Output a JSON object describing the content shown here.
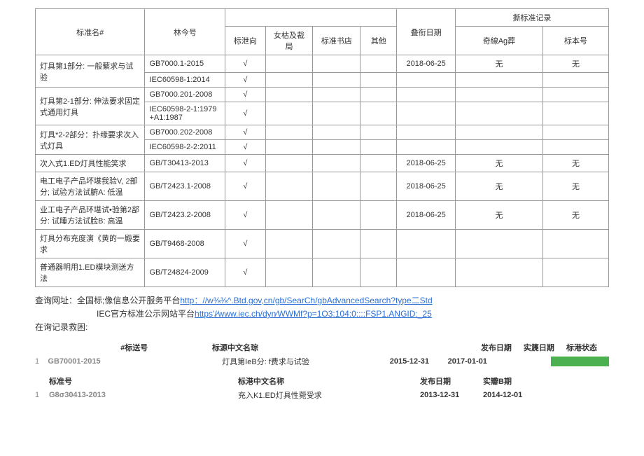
{
  "table": {
    "headers": {
      "name": "标准名#",
      "number": "林今号",
      "group_blank": "",
      "date": "叠衔日期",
      "record_group": "撕标准记录",
      "c1": "标泄向",
      "c2": "女枯及裁局",
      "c3": "标准书店",
      "c4": "其他",
      "r1": "奇線Ag葬",
      "r2": "标本号"
    },
    "rows": [
      {
        "name": "灯具第1部分: 一般蘩求与试验",
        "num": "GB7000.1-2015",
        "c1": "√",
        "c2": "",
        "c3": "",
        "c4": "",
        "date": "2018-06-25",
        "r1": "无",
        "r2": "无",
        "rowspan": 2
      },
      {
        "name": "",
        "num": "IEC60598-1:2014",
        "c1": "√",
        "c2": "",
        "c3": "",
        "c4": "",
        "date": "",
        "r1": "",
        "r2": ""
      },
      {
        "name": "灯具第2-1部分: 伸法要求固定式通用灯具",
        "num": "GB7000.201-2008",
        "c1": "√",
        "c2": "",
        "c3": "",
        "c4": "",
        "date": "",
        "r1": "",
        "r2": "",
        "rowspan": 2
      },
      {
        "name": "",
        "num": "IEC60598-2-1:1979+A1:1987",
        "c1": "√",
        "c2": "",
        "c3": "",
        "c4": "",
        "date": "",
        "r1": "",
        "r2": ""
      },
      {
        "name": "灯具*2-2部分：扑缘要求次入式灯具",
        "num": "GB7000.202-2008",
        "c1": "√",
        "c2": "",
        "c3": "",
        "c4": "",
        "date": "",
        "r1": "",
        "r2": "",
        "rowspan": 2
      },
      {
        "name": "",
        "num": "IEC60598-2-2:2011",
        "c1": "√",
        "c2": "",
        "c3": "",
        "c4": "",
        "date": "",
        "r1": "",
        "r2": ""
      },
      {
        "name": "次入式1.ED灯具性能笑求",
        "num": "GB/T30413-2013",
        "c1": "√",
        "c2": "",
        "c3": "",
        "c4": "",
        "date": "2018-06-25",
        "r1": "无",
        "r2": "无"
      },
      {
        "name": "电工电子产品坏堪我验V, 2部分; 试验方法试腑A: 低温",
        "num": "GB/T2423.1-2008",
        "c1": "√",
        "c2": "",
        "c3": "",
        "c4": "",
        "date": "2018-06-25",
        "r1": "无",
        "r2": "无"
      },
      {
        "name": "业工电子产品环堪试•验第2部分: 试睡方法试脸B: 高温",
        "num": "GB/T2423.2-2008",
        "c1": "√",
        "c2": "",
        "c3": "",
        "c4": "",
        "date": "2018-06-25",
        "r1": "无",
        "r2": "无"
      },
      {
        "name": "灯具分布充度演《黄的一殿要求",
        "num": "GB/T9468-2008",
        "c1": "√",
        "c2": "",
        "c3": "",
        "c4": "",
        "date": "",
        "r1": "",
        "r2": ""
      },
      {
        "name": "普通器明用1.ED模块测送方法",
        "num": "GB/T24824-2009",
        "c1": "√",
        "c2": "",
        "c3": "",
        "c4": "",
        "date": "",
        "r1": "",
        "r2": ""
      }
    ]
  },
  "links": {
    "line1_label": "查询网址：全国标;像信息公开服务平台",
    "line1_url": "http：//w⅜⅜^.Btd.gov,cn/gb/SearCh/gbAdvancedSearch?type二Std",
    "line2_label": "IEC官方标准公示网站平台",
    "line2_url": "https'/∕www.iec.ch/dyn∕WWMf?p=1O3:104:0::::FSP1.ANGID:_25",
    "line3": "在询记录救困:"
  },
  "records": {
    "h1": {
      "code": "#标送号",
      "name": "标源中文名琮",
      "d3": "发布日期",
      "d4": "实篪日期",
      "d5": "标港状态"
    },
    "row1": {
      "idx": "1",
      "code": "GB70001-2015",
      "name": "灯具第IeB分: f费求与试验",
      "d1": "2015-12-31",
      "d2": "2017-01-01"
    },
    "h2": {
      "code": "标准号",
      "name": "标港中文名称",
      "d1": "发布日期",
      "d2": "实瓣B期"
    },
    "row2": {
      "idx": "1",
      "code": "G8σ30413-2013",
      "name": "充入K1.ED灯具性菀受求",
      "d1": "2013-12-31",
      "d2": "2014-12-01"
    }
  }
}
